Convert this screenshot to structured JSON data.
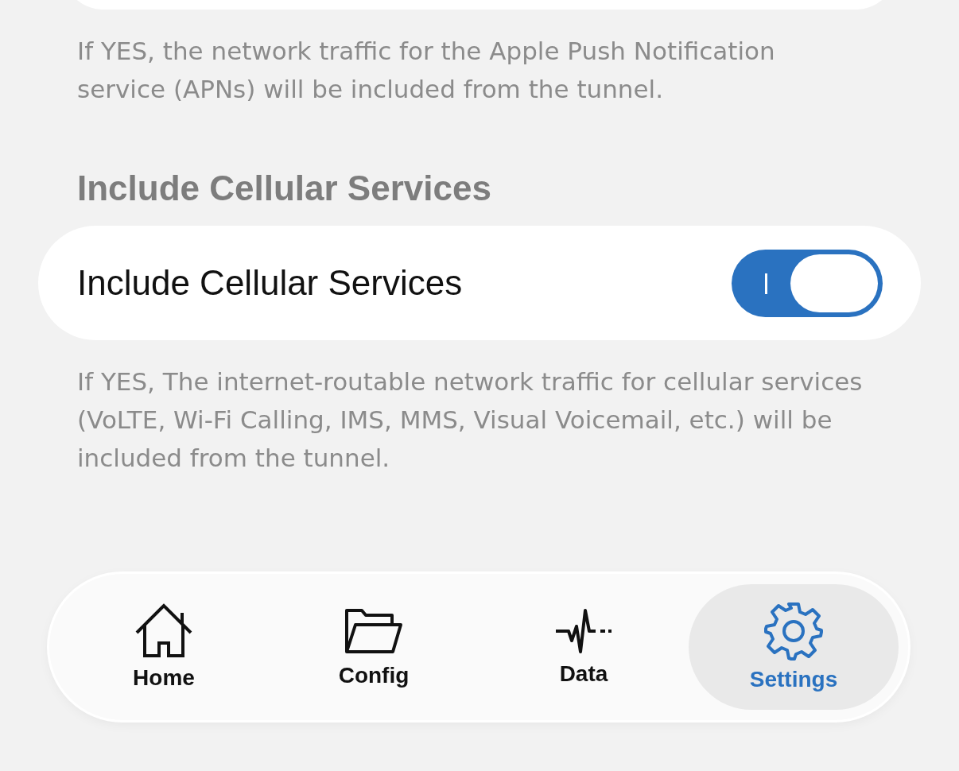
{
  "sections": [
    {
      "footer": "If YES, the network traffic for the Apple Push Notification service (APNs) will be included from the tunnel."
    },
    {
      "header": "Include Cellular Services",
      "rows": [
        {
          "label": "Include Cellular Services",
          "on": true
        }
      ],
      "footer": "If YES, The internet-routable network traffic for cellular services (VoLTE, Wi-Fi Calling, IMS, MMS, Visual Voicemail, etc.) will be included from the tunnel."
    }
  ],
  "tab_bar": [
    {
      "kind": "home",
      "label": "Home",
      "selected": false
    },
    {
      "kind": "folder",
      "label": "Config",
      "selected": false
    },
    {
      "kind": "pulse",
      "label": "Data",
      "selected": false
    },
    {
      "kind": "gear",
      "label": "Settings",
      "selected": true
    }
  ]
}
